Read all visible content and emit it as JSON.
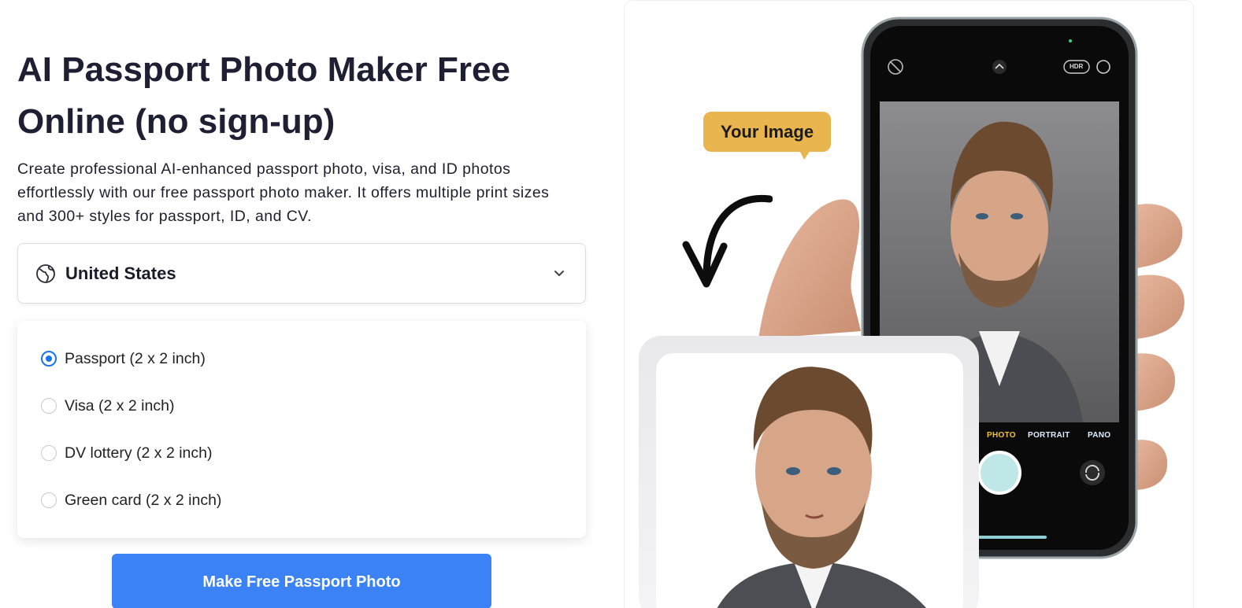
{
  "hero": {
    "title": "AI Passport Photo Maker Free Online (no sign-up)",
    "description": "Create professional AI-enhanced passport photo, visa, and ID photos effortlessly with our free passport photo maker. It offers multiple print sizes and 300+ styles for passport, ID, and CV."
  },
  "country_select": {
    "icon": "globe-icon",
    "value": "United States",
    "chevron": "chevron-down-icon"
  },
  "document_types": [
    {
      "label": "Passport (2 x 2 inch)",
      "selected": true
    },
    {
      "label": "Visa (2 x 2 inch)",
      "selected": false
    },
    {
      "label": "DV lottery (2 x 2 inch)",
      "selected": false
    },
    {
      "label": "Green card (2 x 2 inch)",
      "selected": false
    }
  ],
  "cta": {
    "label": "Make Free Passport Photo"
  },
  "illustration": {
    "bubble": "Your Image",
    "camera_modes": [
      "PHOTO",
      "PORTRAIT",
      "PANO"
    ],
    "camera_badge": "HDR",
    "colors": {
      "accent": "#3b82f6",
      "radio": "#1a73e8",
      "bubble": "#e9b54f"
    }
  }
}
